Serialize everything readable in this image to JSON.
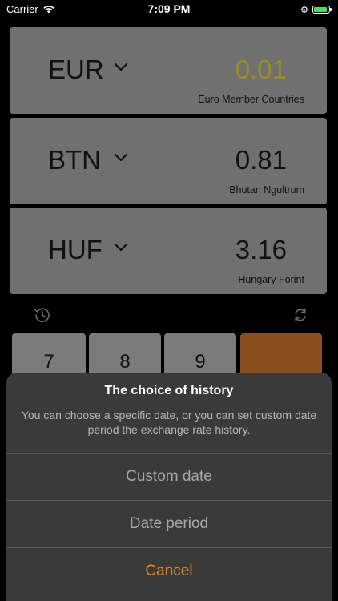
{
  "status_bar": {
    "carrier": "Carrier",
    "time": "7:09 PM",
    "wifi_icon": "wifi-icon",
    "battery_icon": "battery-icon",
    "battery_level": 0.8
  },
  "currencies": [
    {
      "code": "EUR",
      "value": "0.01",
      "name": "Euro Member Countries",
      "active": true
    },
    {
      "code": "BTN",
      "value": "0.81",
      "name": "Bhutan Ngultrum",
      "active": false
    },
    {
      "code": "HUF",
      "value": "3.16",
      "name": "Hungary Forint",
      "active": false
    }
  ],
  "toolbar": {
    "history_icon": "history-icon",
    "refresh_icon": "refresh-icon"
  },
  "keypad": {
    "keys": [
      "7",
      "8",
      "9",
      ""
    ]
  },
  "action_sheet": {
    "title": "The choice of history",
    "message": "You can choose a specific date, or you can set custom date period the exchange rate history.",
    "actions": [
      "Custom date",
      "Date period"
    ],
    "cancel": "Cancel"
  },
  "colors": {
    "card_bg": "#707070",
    "active_value": "#9c8a2a",
    "operator_key": "#8a4f1e",
    "sheet_bg": "#3a3a3a",
    "cancel": "#e8851c"
  }
}
